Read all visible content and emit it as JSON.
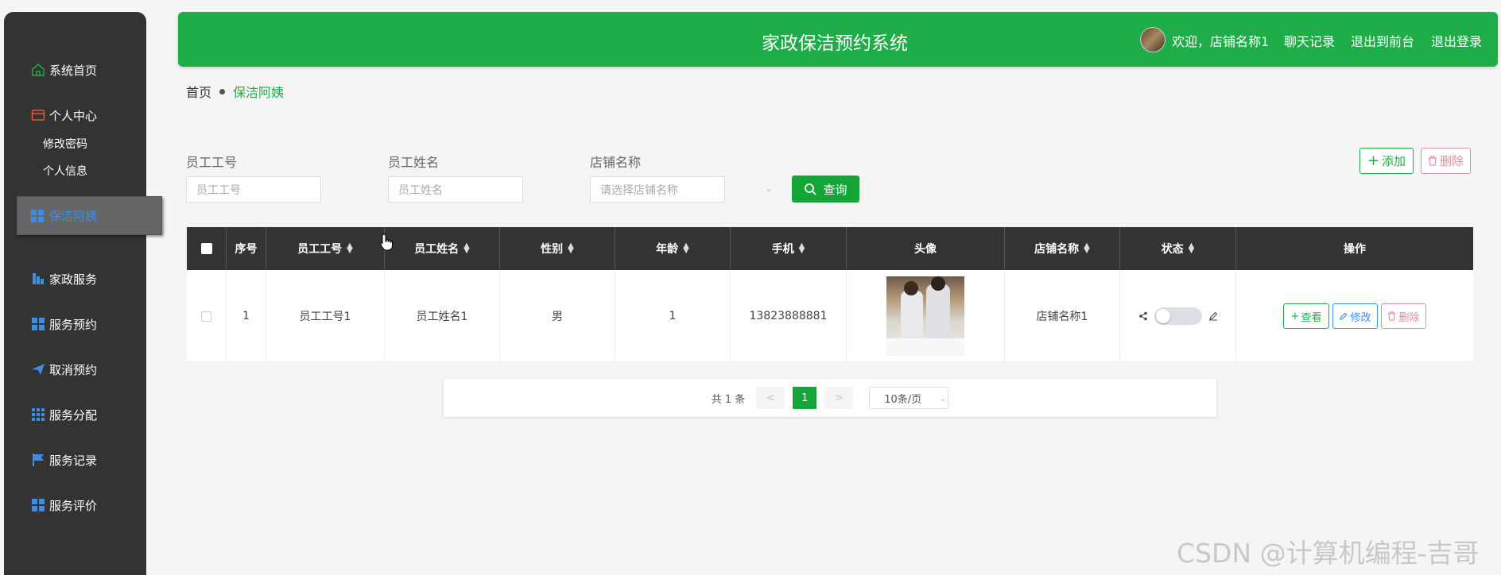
{
  "sidebar": {
    "items": [
      {
        "label": "系统首页",
        "icon": "home-icon"
      },
      {
        "label": "个人中心",
        "icon": "wallet-icon"
      },
      {
        "label": "保洁阿姨",
        "icon": "grid-icon",
        "active": true
      },
      {
        "label": "家政服务",
        "icon": "chart-icon"
      },
      {
        "label": "服务预约",
        "icon": "grid-icon"
      },
      {
        "label": "取消预约",
        "icon": "paper-plane-icon"
      },
      {
        "label": "服务分配",
        "icon": "grid-dots-icon"
      },
      {
        "label": "服务记录",
        "icon": "flag-icon"
      },
      {
        "label": "服务评价",
        "icon": "grid-icon"
      }
    ],
    "sub_items": [
      "修改密码",
      "个人信息"
    ]
  },
  "header": {
    "title": "家政保洁预约系统",
    "welcome": "欢迎，店铺名称1",
    "links": [
      "聊天记录",
      "退出到前台",
      "退出登录"
    ]
  },
  "breadcrumb": {
    "home": "首页",
    "current": "保洁阿姨"
  },
  "search": {
    "fields": [
      {
        "label": "员工工号",
        "placeholder": "员工工号"
      },
      {
        "label": "员工姓名",
        "placeholder": "员工姓名"
      },
      {
        "label": "店铺名称",
        "placeholder": "请选择店铺名称"
      }
    ],
    "search_button": "查询",
    "add_button": "添加",
    "delete_button": "删除"
  },
  "table": {
    "columns": [
      "序号",
      "员工工号",
      "员工姓名",
      "性别",
      "年龄",
      "手机",
      "头像",
      "店铺名称",
      "状态",
      "操作"
    ],
    "rows": [
      {
        "index": "1",
        "emp_no": "员工工号1",
        "emp_name": "员工姓名1",
        "gender": "男",
        "age": "1",
        "phone": "13823888881",
        "shop": "店铺名称1",
        "status_on": false
      }
    ],
    "row_actions": [
      "查看",
      "修改",
      "删除"
    ]
  },
  "pagination": {
    "total": "共 1 条",
    "prev": "<",
    "current": "1",
    "next": ">",
    "page_size": "10条/页"
  },
  "watermark": "CSDN @计算机编程-吉哥",
  "colors": {
    "accent": "#1ead48",
    "sidebar": "#333333",
    "danger": "#e68a9c",
    "info": "#3a8ee6"
  }
}
